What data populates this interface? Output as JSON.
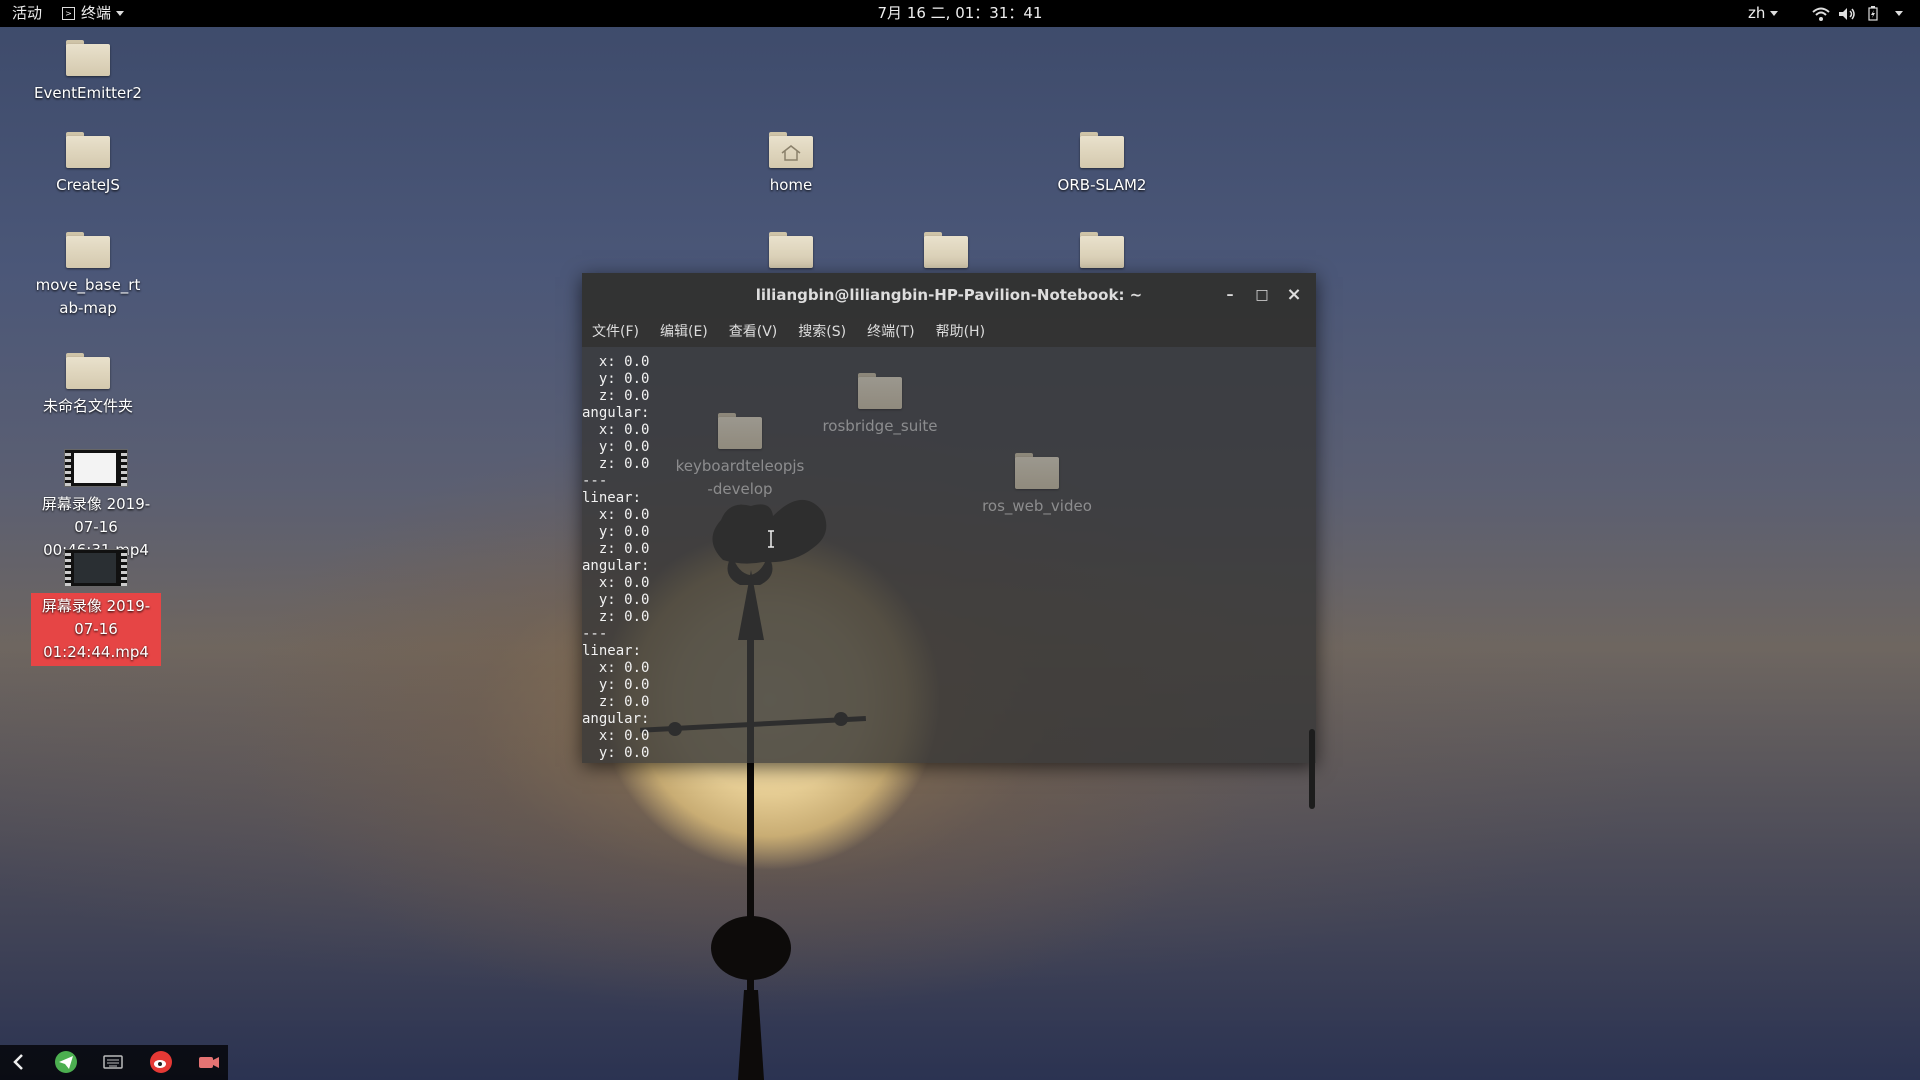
{
  "topbar": {
    "activities": "活动",
    "app_menu": "终端",
    "clock": "7月 16 二, 01：31：41",
    "language": "zh"
  },
  "desktop": {
    "icons_left": [
      {
        "label": "EventEmitter2",
        "type": "folder"
      },
      {
        "label": "CreateJS",
        "type": "folder"
      },
      {
        "label": "move_base_rtab-map",
        "type": "folder"
      },
      {
        "label": "未命名文件夹",
        "type": "folder"
      },
      {
        "label": "屏幕录像 2019-07-16 00:46:31.mp4",
        "type": "video"
      },
      {
        "label": "屏幕录像 2019-07-16 01:24:44.mp4",
        "type": "video",
        "selected": true
      }
    ],
    "icons_middle": [
      {
        "label": "home",
        "type": "home-folder"
      },
      {
        "label": "ORB-SLAM2",
        "type": "folder"
      },
      {
        "label": "keyboardteleopjs-develop",
        "type": "folder"
      },
      {
        "label": "rosbridge_suite",
        "type": "folder"
      },
      {
        "label": "ros_web_video",
        "type": "folder"
      }
    ]
  },
  "terminal": {
    "title": "liliangbin@liliangbin-HP-Pavilion-Notebook: ~",
    "menu": [
      "文件(F)",
      "编辑(E)",
      "查看(V)",
      "搜索(S)",
      "终端(T)",
      "帮助(H)"
    ],
    "lines": [
      "  x: 0.0",
      "  y: 0.0",
      "  z: 0.0",
      "angular:",
      "  x: 0.0",
      "  y: 0.0",
      "  z: 0.0",
      "---",
      "linear:",
      "  x: 0.0",
      "  y: 0.0",
      "  z: 0.0",
      "angular:",
      "  x: 0.0",
      "  y: 0.0",
      "  z: 0.0",
      "---",
      "linear:",
      "  x: 0.0",
      "  y: 0.0",
      "  z: 0.0",
      "angular:",
      "  x: 0.0",
      "  y: 0.0"
    ],
    "minimize": "–",
    "maximize": "□",
    "close": "×"
  },
  "dock": {
    "items": [
      "back-arrow-icon",
      "telegram-icon",
      "keyboard-icon",
      "weibo-icon",
      "camera-icon"
    ]
  },
  "colors": {
    "selection": "#e64545",
    "topbar": "#000000"
  }
}
